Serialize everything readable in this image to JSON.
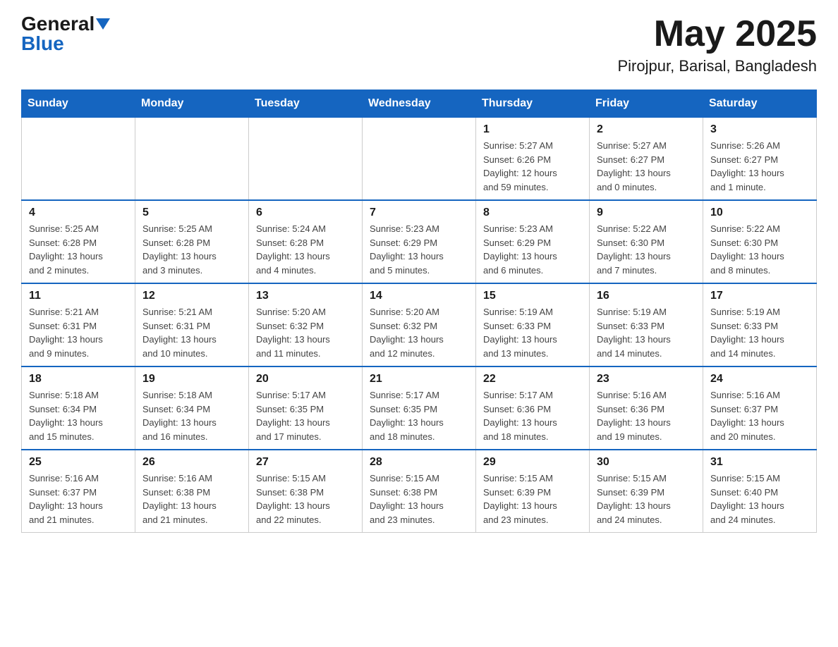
{
  "header": {
    "logo_general": "General",
    "logo_blue": "Blue",
    "month_title": "May 2025",
    "location": "Pirojpur, Barisal, Bangladesh"
  },
  "days_of_week": [
    "Sunday",
    "Monday",
    "Tuesday",
    "Wednesday",
    "Thursday",
    "Friday",
    "Saturday"
  ],
  "weeks": [
    [
      {
        "day": "",
        "info": ""
      },
      {
        "day": "",
        "info": ""
      },
      {
        "day": "",
        "info": ""
      },
      {
        "day": "",
        "info": ""
      },
      {
        "day": "1",
        "info": "Sunrise: 5:27 AM\nSunset: 6:26 PM\nDaylight: 12 hours\nand 59 minutes."
      },
      {
        "day": "2",
        "info": "Sunrise: 5:27 AM\nSunset: 6:27 PM\nDaylight: 13 hours\nand 0 minutes."
      },
      {
        "day": "3",
        "info": "Sunrise: 5:26 AM\nSunset: 6:27 PM\nDaylight: 13 hours\nand 1 minute."
      }
    ],
    [
      {
        "day": "4",
        "info": "Sunrise: 5:25 AM\nSunset: 6:28 PM\nDaylight: 13 hours\nand 2 minutes."
      },
      {
        "day": "5",
        "info": "Sunrise: 5:25 AM\nSunset: 6:28 PM\nDaylight: 13 hours\nand 3 minutes."
      },
      {
        "day": "6",
        "info": "Sunrise: 5:24 AM\nSunset: 6:28 PM\nDaylight: 13 hours\nand 4 minutes."
      },
      {
        "day": "7",
        "info": "Sunrise: 5:23 AM\nSunset: 6:29 PM\nDaylight: 13 hours\nand 5 minutes."
      },
      {
        "day": "8",
        "info": "Sunrise: 5:23 AM\nSunset: 6:29 PM\nDaylight: 13 hours\nand 6 minutes."
      },
      {
        "day": "9",
        "info": "Sunrise: 5:22 AM\nSunset: 6:30 PM\nDaylight: 13 hours\nand 7 minutes."
      },
      {
        "day": "10",
        "info": "Sunrise: 5:22 AM\nSunset: 6:30 PM\nDaylight: 13 hours\nand 8 minutes."
      }
    ],
    [
      {
        "day": "11",
        "info": "Sunrise: 5:21 AM\nSunset: 6:31 PM\nDaylight: 13 hours\nand 9 minutes."
      },
      {
        "day": "12",
        "info": "Sunrise: 5:21 AM\nSunset: 6:31 PM\nDaylight: 13 hours\nand 10 minutes."
      },
      {
        "day": "13",
        "info": "Sunrise: 5:20 AM\nSunset: 6:32 PM\nDaylight: 13 hours\nand 11 minutes."
      },
      {
        "day": "14",
        "info": "Sunrise: 5:20 AM\nSunset: 6:32 PM\nDaylight: 13 hours\nand 12 minutes."
      },
      {
        "day": "15",
        "info": "Sunrise: 5:19 AM\nSunset: 6:33 PM\nDaylight: 13 hours\nand 13 minutes."
      },
      {
        "day": "16",
        "info": "Sunrise: 5:19 AM\nSunset: 6:33 PM\nDaylight: 13 hours\nand 14 minutes."
      },
      {
        "day": "17",
        "info": "Sunrise: 5:19 AM\nSunset: 6:33 PM\nDaylight: 13 hours\nand 14 minutes."
      }
    ],
    [
      {
        "day": "18",
        "info": "Sunrise: 5:18 AM\nSunset: 6:34 PM\nDaylight: 13 hours\nand 15 minutes."
      },
      {
        "day": "19",
        "info": "Sunrise: 5:18 AM\nSunset: 6:34 PM\nDaylight: 13 hours\nand 16 minutes."
      },
      {
        "day": "20",
        "info": "Sunrise: 5:17 AM\nSunset: 6:35 PM\nDaylight: 13 hours\nand 17 minutes."
      },
      {
        "day": "21",
        "info": "Sunrise: 5:17 AM\nSunset: 6:35 PM\nDaylight: 13 hours\nand 18 minutes."
      },
      {
        "day": "22",
        "info": "Sunrise: 5:17 AM\nSunset: 6:36 PM\nDaylight: 13 hours\nand 18 minutes."
      },
      {
        "day": "23",
        "info": "Sunrise: 5:16 AM\nSunset: 6:36 PM\nDaylight: 13 hours\nand 19 minutes."
      },
      {
        "day": "24",
        "info": "Sunrise: 5:16 AM\nSunset: 6:37 PM\nDaylight: 13 hours\nand 20 minutes."
      }
    ],
    [
      {
        "day": "25",
        "info": "Sunrise: 5:16 AM\nSunset: 6:37 PM\nDaylight: 13 hours\nand 21 minutes."
      },
      {
        "day": "26",
        "info": "Sunrise: 5:16 AM\nSunset: 6:38 PM\nDaylight: 13 hours\nand 21 minutes."
      },
      {
        "day": "27",
        "info": "Sunrise: 5:15 AM\nSunset: 6:38 PM\nDaylight: 13 hours\nand 22 minutes."
      },
      {
        "day": "28",
        "info": "Sunrise: 5:15 AM\nSunset: 6:38 PM\nDaylight: 13 hours\nand 23 minutes."
      },
      {
        "day": "29",
        "info": "Sunrise: 5:15 AM\nSunset: 6:39 PM\nDaylight: 13 hours\nand 23 minutes."
      },
      {
        "day": "30",
        "info": "Sunrise: 5:15 AM\nSunset: 6:39 PM\nDaylight: 13 hours\nand 24 minutes."
      },
      {
        "day": "31",
        "info": "Sunrise: 5:15 AM\nSunset: 6:40 PM\nDaylight: 13 hours\nand 24 minutes."
      }
    ]
  ]
}
